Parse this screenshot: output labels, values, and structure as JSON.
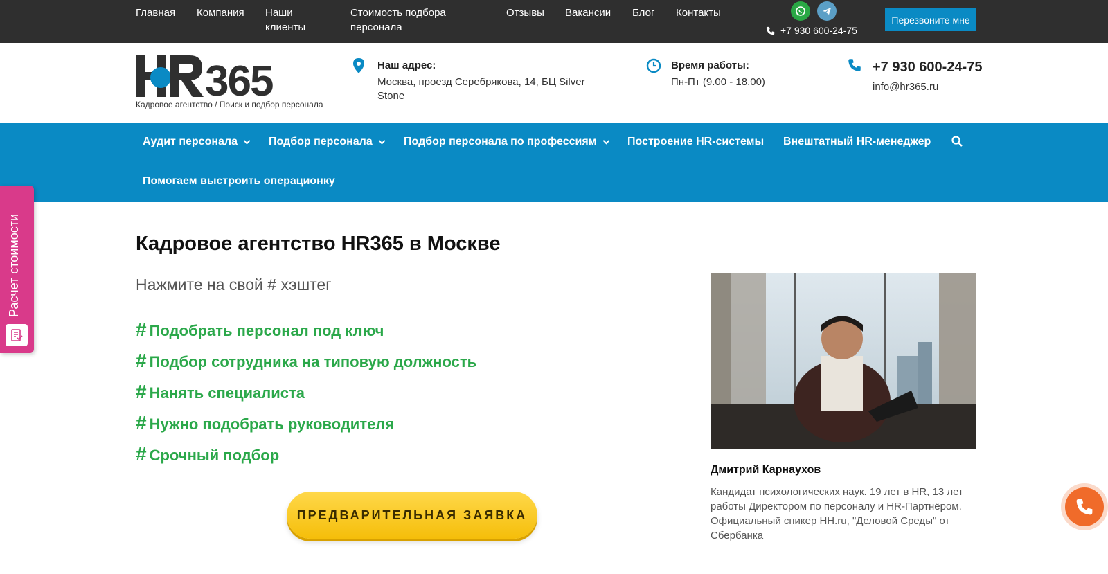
{
  "topbar": {
    "nav": [
      "Главная",
      "Компания",
      "Наши клиенты",
      "Стоимость подбора персонала",
      "Отзывы",
      "Вакансии",
      "Блог",
      "Контакты"
    ],
    "phone": "+7 930 600-24-75",
    "callback_label": "Перезвоните мне"
  },
  "header": {
    "logo_tagline": "Кадровое агентство / Поиск и подбор персонала",
    "address_title": "Наш адрес:",
    "address_text": "Москва, проезд Серебрякова, 14, БЦ Silver Stone",
    "hours_title": "Время работы:",
    "hours_text": "Пн-Пт (9.00 - 18.00)",
    "phone": "+7 930 600-24-75",
    "email": "info@hr365.ru"
  },
  "mainnav": {
    "items": [
      "Аудит персонала",
      "Подбор персонала",
      "Подбор персонала по профессиям",
      "Построение HR-системы",
      "Внештатный HR-менеджер",
      "Помогаем выстроить операционку"
    ]
  },
  "sidetab": {
    "label": "Расчет стоимости"
  },
  "content": {
    "title": "Кадровое агентство HR365 в Москве",
    "subtitle": "Нажмите на свой # хэштег",
    "hashtags": [
      "Подобрать персонал под ключ",
      "Подбор сотрудника на типовую должность",
      "Нанять специалиста",
      "Нужно подобрать руководителя",
      "Срочный подбор"
    ],
    "cta_label": "ПРЕДВАРИТЕЛЬНАЯ ЗАЯВКА"
  },
  "bio": {
    "name": "Дмитрий Карнаухов",
    "text": "Кандидат психологических наук. 19 лет в HR, 13 лет работы Директором по персоналу и HR-Партнёром. Официальный спикер HH.ru, \"Деловой Среды\" от Сбербанка"
  },
  "colors": {
    "topbar_bg": "#2f2f2f",
    "accent_blue": "#0a8ac4",
    "hashtag_green": "#2ba84a",
    "cta_yellow": "#f5be0a",
    "sidetab_pink": "#d93a8a",
    "call_orange": "#f06b2a"
  }
}
